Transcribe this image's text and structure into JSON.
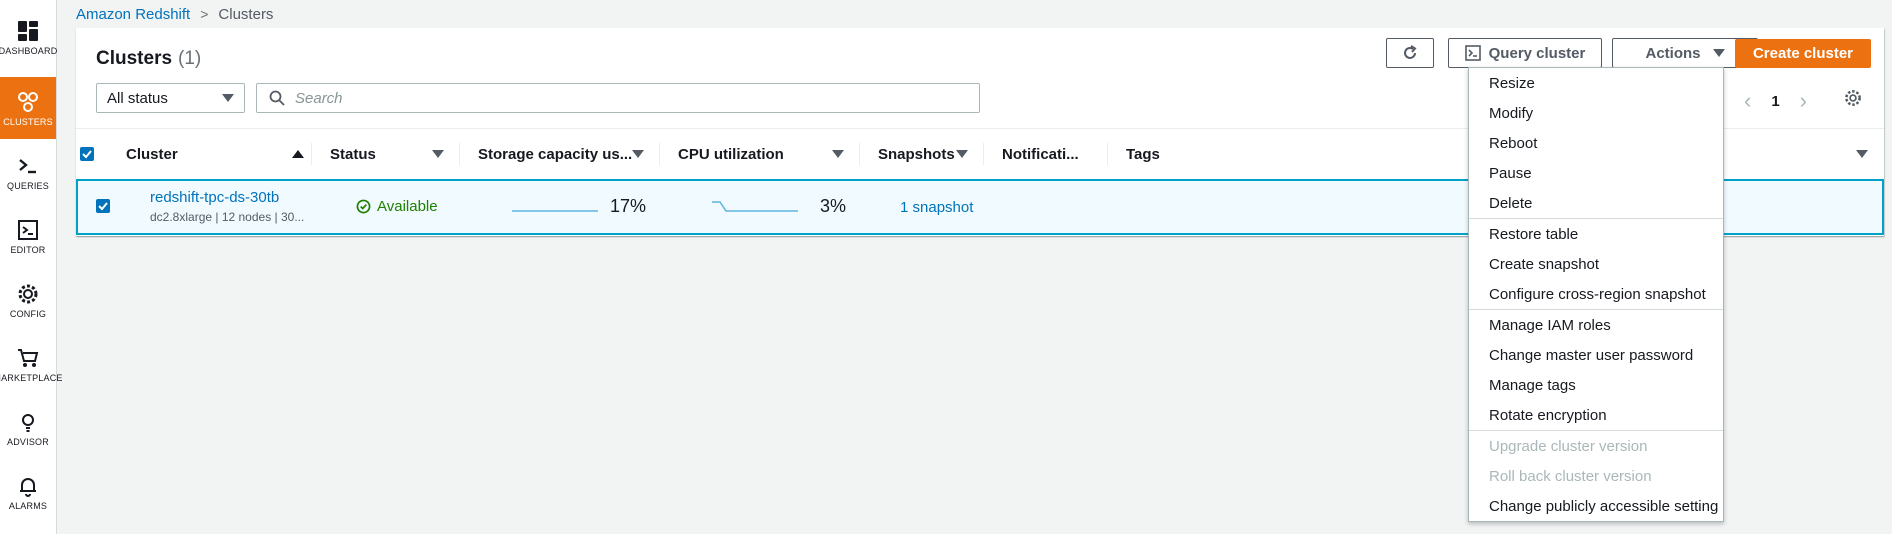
{
  "breadcrumb": {
    "root": "Amazon Redshift",
    "current": "Clusters"
  },
  "sidebar": [
    {
      "label": "DASHBOARD",
      "icon": "dashboard-icon",
      "active": false
    },
    {
      "label": "CLUSTERS",
      "icon": "clusters-icon",
      "active": true
    },
    {
      "label": "QUERIES",
      "icon": "queries-icon",
      "active": false
    },
    {
      "label": "EDITOR",
      "icon": "editor-icon",
      "active": false
    },
    {
      "label": "CONFIG",
      "icon": "gear-icon",
      "active": false
    },
    {
      "label": "MARKETPLACE",
      "icon": "cart-icon",
      "active": false
    },
    {
      "label": "ADVISOR",
      "icon": "lightbulb-icon",
      "active": false
    },
    {
      "label": "ALARMS",
      "icon": "bell-icon",
      "active": false
    }
  ],
  "header": {
    "title": "Clusters",
    "count": "(1)"
  },
  "toolbar": {
    "refresh_icon": "refresh-icon",
    "query_label": "Query cluster",
    "actions_label": "Actions",
    "create_label": "Create cluster"
  },
  "filter": {
    "status": "All status",
    "search_placeholder": "Search"
  },
  "pagination": {
    "page": "1"
  },
  "table": {
    "columns": [
      "Cluster",
      "Status",
      "Storage capacity us...",
      "CPU utilization",
      "Snapshots",
      "Notificati...",
      "Tags"
    ],
    "rows": [
      {
        "name": "redshift-tpc-ds-30tb",
        "detail": "dc2.8xlarge | 12 nodes | 30...",
        "status": "Available",
        "storage": "17%",
        "storage_fraction": 0.17,
        "cpu": "3%",
        "cpu_fraction": 0.03,
        "snapshots": "1 snapshot"
      }
    ]
  },
  "actions_menu": [
    [
      {
        "label": "Resize"
      },
      {
        "label": "Modify"
      },
      {
        "label": "Reboot"
      },
      {
        "label": "Pause"
      },
      {
        "label": "Delete"
      }
    ],
    [
      {
        "label": "Restore table"
      },
      {
        "label": "Create snapshot"
      },
      {
        "label": "Configure cross-region snapshot"
      }
    ],
    [
      {
        "label": "Manage IAM roles"
      },
      {
        "label": "Change master user password"
      },
      {
        "label": "Manage tags"
      },
      {
        "label": "Rotate encryption"
      }
    ],
    [
      {
        "label": "Upgrade cluster version",
        "disabled": true
      },
      {
        "label": "Roll back cluster version",
        "disabled": true
      },
      {
        "label": "Change publicly accessible setting"
      }
    ]
  ],
  "colors": {
    "accent": "#ec7211",
    "link": "#0073bb",
    "success": "#1d8102",
    "selected_row": "#f1faff",
    "selected_border": "#00a1c9"
  }
}
